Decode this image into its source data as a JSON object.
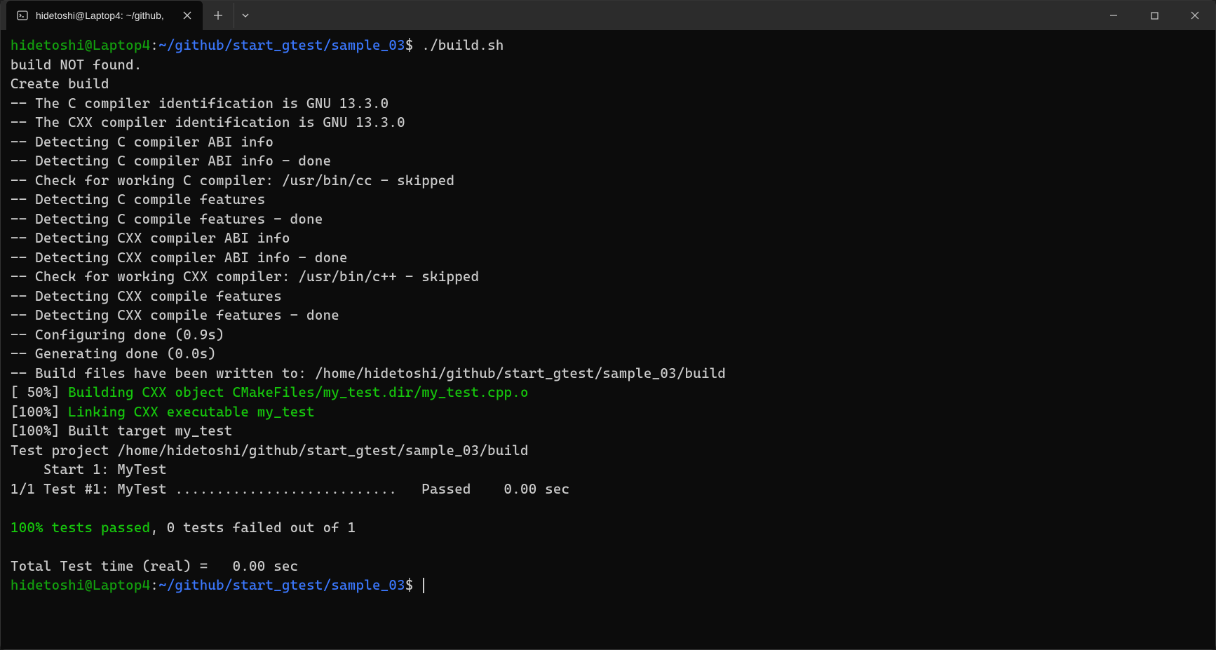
{
  "tab": {
    "title": "hidetoshi@Laptop4: ~/github,"
  },
  "prompt1": {
    "user_host": "hidetoshi@Laptop4",
    "colon": ":",
    "path": "~/github/start_gtest/sample_03",
    "dollar": "$",
    "command": " ./build.sh"
  },
  "lines": [
    "build NOT found.",
    "Create build",
    "-- The C compiler identification is GNU 13.3.0",
    "-- The CXX compiler identification is GNU 13.3.0",
    "-- Detecting C compiler ABI info",
    "-- Detecting C compiler ABI info - done",
    "-- Check for working C compiler: /usr/bin/cc - skipped",
    "-- Detecting C compile features",
    "-- Detecting C compile features - done",
    "-- Detecting CXX compiler ABI info",
    "-- Detecting CXX compiler ABI info - done",
    "-- Check for working CXX compiler: /usr/bin/c++ - skipped",
    "-- Detecting CXX compile features",
    "-- Detecting CXX compile features - done",
    "-- Configuring done (0.9s)",
    "-- Generating done (0.0s)",
    "-- Build files have been written to: /home/hidetoshi/github/start_gtest/sample_03/build"
  ],
  "build50": {
    "percent": "[ 50%] ",
    "text": "Building CXX object CMakeFiles/my_test.dir/my_test.cpp.o"
  },
  "build100": {
    "percent": "[100%] ",
    "text": "Linking CXX executable my_test"
  },
  "built": "[100%] Built target my_test",
  "testproj": "Test project /home/hidetoshi/github/start_gtest/sample_03/build",
  "start": "    Start 1: MyTest",
  "testresult": "1/1 Test #1: MyTest ...........................   Passed    0.00 sec",
  "blank": "",
  "passed": {
    "green": "100% tests passed",
    "rest": ", 0 tests failed out of 1"
  },
  "totaltime": "Total Test time (real) =   0.00 sec",
  "prompt2": {
    "user_host": "hidetoshi@Laptop4",
    "colon": ":",
    "path": "~/github/start_gtest/sample_03",
    "dollar": "$"
  }
}
